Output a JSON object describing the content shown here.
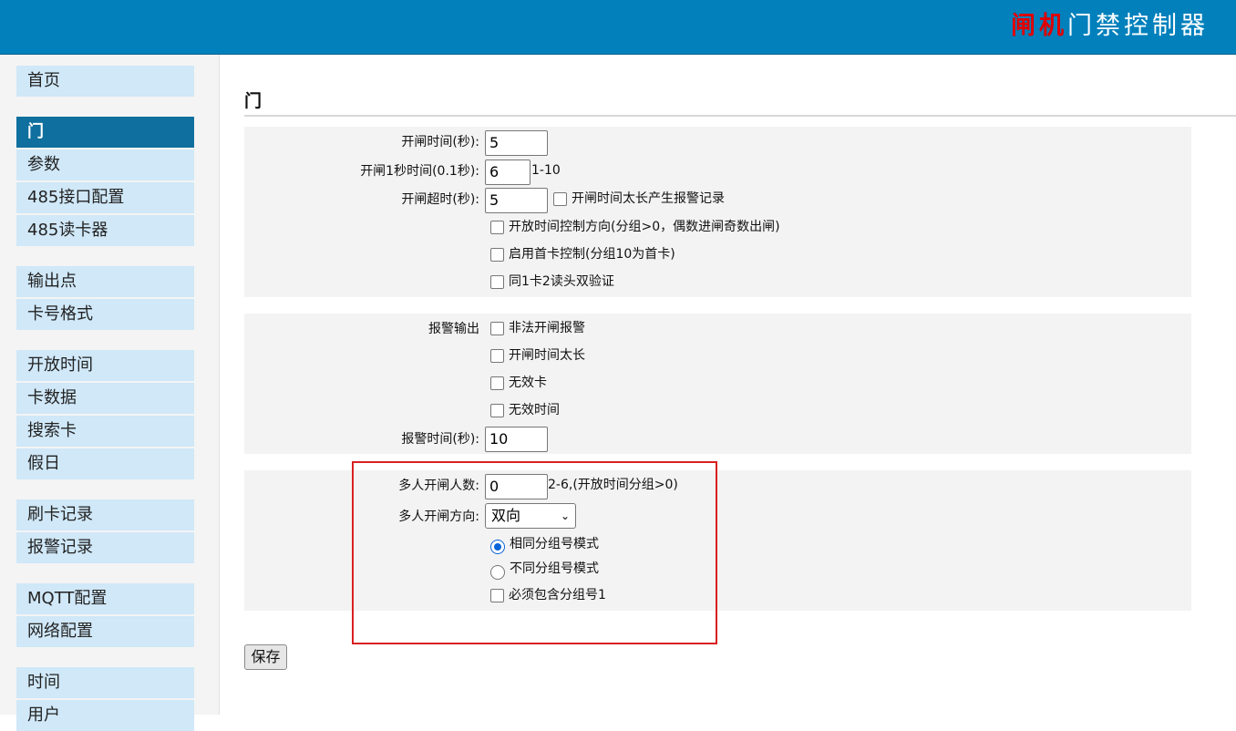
{
  "header": {
    "brand_highlight": "闸机",
    "brand_rest": "门禁控制器"
  },
  "sidebar": {
    "items": [
      {
        "label": "首页"
      },
      {
        "label": "门"
      },
      {
        "label": "参数"
      },
      {
        "label": "485接口配置"
      },
      {
        "label": "485读卡器"
      },
      {
        "label": "输出点"
      },
      {
        "label": "卡号格式"
      },
      {
        "label": "开放时间"
      },
      {
        "label": "卡数据"
      },
      {
        "label": "搜索卡"
      },
      {
        "label": "假日"
      },
      {
        "label": "刷卡记录"
      },
      {
        "label": "报警记录"
      },
      {
        "label": "MQTT配置"
      },
      {
        "label": "网络配置"
      },
      {
        "label": "时间"
      },
      {
        "label": "用户"
      }
    ],
    "active": "门"
  },
  "main": {
    "title": "门",
    "door_settings": {
      "open_time_label": "开闸时间(秒):",
      "open_time_value": "5",
      "open_1s_label": "开闸1秒时间(0.1秒):",
      "open_1s_value": "6",
      "open_1s_range": "1-10",
      "open_timeout_label": "开闸超时(秒):",
      "open_timeout_value": "5",
      "open_too_long_alarm_label": "开闸时间太长产生报警记录",
      "open_too_long_alarm_checked": false,
      "direction_control_label": "开放时间控制方向(分组>0，偶数进闸奇数出闸)",
      "direction_control_checked": false,
      "first_card_label": "启用首卡控制(分组10为首卡)",
      "first_card_checked": false,
      "dual_verify_label": "同1卡2读头双验证",
      "dual_verify_checked": false
    },
    "alarm_settings": {
      "alarm_output_label": "报警输出",
      "illegal_open_label": "非法开闸报警",
      "illegal_open_checked": false,
      "open_too_long_label": "开闸时间太长",
      "open_too_long_checked": false,
      "invalid_card_label": "无效卡",
      "invalid_card_checked": false,
      "invalid_time_label": "无效时间",
      "invalid_time_checked": false,
      "alarm_time_label": "报警时间(秒):",
      "alarm_time_value": "10"
    },
    "multi_person": {
      "count_label": "多人开闸人数:",
      "count_value": "0",
      "count_hint": "2-6,(开放时间分组>0)",
      "direction_label": "多人开闸方向:",
      "direction_value": "双向",
      "same_group_label": "相同分组号模式",
      "same_group_selected": true,
      "diff_group_label": "不同分组号模式",
      "diff_group_selected": false,
      "must_include_label": "必须包含分组号1",
      "must_include_checked": false
    },
    "save_label": "保存"
  },
  "colors": {
    "header_bg": "#0180bc",
    "brand_red": "#e00000",
    "nav_bg": "#d0e8f8",
    "nav_active_bg": "#0f6f9e",
    "highlight_border": "#d92020"
  }
}
